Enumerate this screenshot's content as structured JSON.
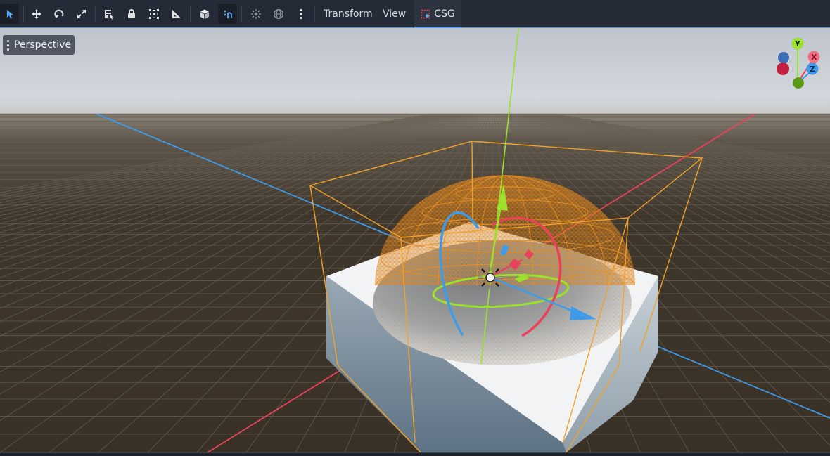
{
  "toolbar": {
    "tools": [
      {
        "name": "select-tool",
        "icon": "pointer-arrow-icon",
        "active": true
      },
      {
        "name": "move-tool",
        "icon": "move-arrows-icon"
      },
      {
        "name": "rotate-tool",
        "icon": "rotate-icon"
      },
      {
        "name": "scale-tool",
        "icon": "scale-icon"
      },
      {
        "name": "list-select-tool",
        "icon": "list-select-icon"
      },
      {
        "name": "lock-tool",
        "icon": "lock-icon"
      },
      {
        "name": "group-tool",
        "icon": "group-icon"
      },
      {
        "name": "ruler-tool",
        "icon": "ruler-icon"
      },
      {
        "name": "local-space-toggle",
        "icon": "cube-icon"
      },
      {
        "name": "snap-toggle",
        "icon": "snap-magnet-icon",
        "active": true
      },
      {
        "name": "sun-preview-toggle",
        "icon": "sun-icon"
      },
      {
        "name": "environment-preview-toggle",
        "icon": "globe-icon"
      },
      {
        "name": "more-options",
        "icon": "vertical-dots-icon"
      }
    ],
    "menus": {
      "transform": "Transform",
      "view": "View"
    },
    "csg_tab": {
      "label": "CSG",
      "icon": "csg-dotted-box-icon"
    }
  },
  "viewport": {
    "view_mode_label": "Perspective",
    "gizmo": {
      "y_label": "Y",
      "x_label": "X",
      "z_label": "Z"
    }
  },
  "colors": {
    "toolbar_bg": "#252b36",
    "accent": "#5b9ee6",
    "axis_x": "#e8435a",
    "axis_y": "#9ae02c",
    "axis_z": "#3d9bea",
    "selection": "#f0a22a",
    "ground": "#3a3127",
    "sky": "#c9ced6"
  }
}
